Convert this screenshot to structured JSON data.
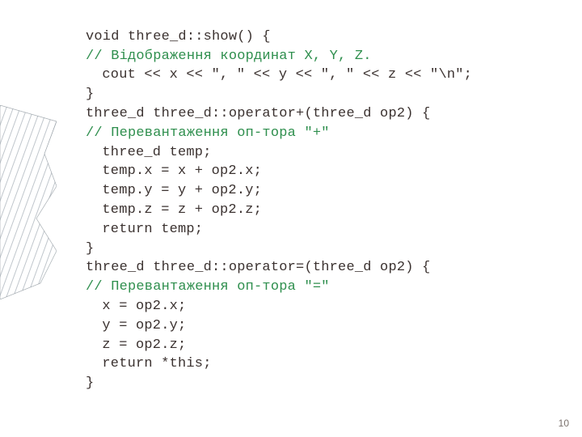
{
  "code": {
    "l1": "void three_d::show() {",
    "l2": "// Відображення координат X, Y, Z.",
    "l3": "cout << x << \", \" << y << \", \" << z << \"\\n\";",
    "l4": "}",
    "l5": "three_d three_d::operator+(three_d op2) {",
    "l6": "// Перевантаження оп-тора \"+\"",
    "l7": "three_d temp;",
    "l8": "temp.x = x + op2.x;",
    "l9": "temp.y = y + op2.y;",
    "l10": "temp.z = z + op2.z;",
    "l11": "return temp;",
    "l12": "}",
    "l13": "three_d three_d::operator=(three_d op2) {",
    "l14": "// Перевантаження оп-тора \"=\"",
    "l15": "x = op2.x;",
    "l16": "y = op2.y;",
    "l17": "z = op2.z;",
    "l18": "return *this;",
    "l19": "}"
  },
  "page_number": "10"
}
